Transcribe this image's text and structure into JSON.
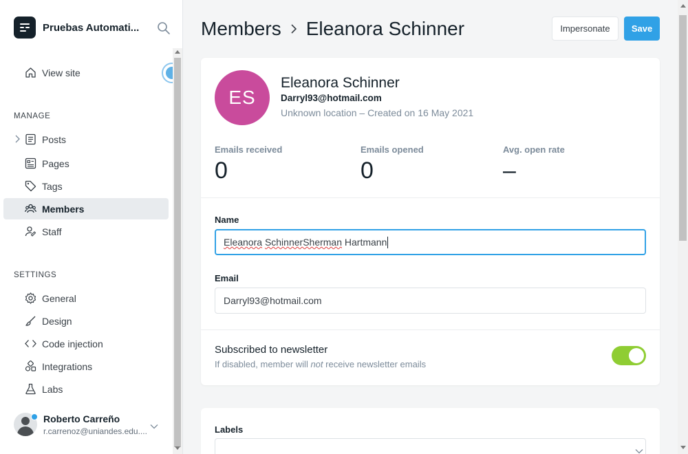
{
  "sidebar": {
    "brand": {
      "name": "Pruebas Automati..."
    },
    "view_site": "View site",
    "manage_title": "MANAGE",
    "manage_items": [
      {
        "label": "Posts",
        "icon": "posts-icon"
      },
      {
        "label": "Pages",
        "icon": "pages-icon"
      },
      {
        "label": "Tags",
        "icon": "tag-icon"
      },
      {
        "label": "Members",
        "icon": "members-icon",
        "active": true
      },
      {
        "label": "Staff",
        "icon": "staff-icon"
      }
    ],
    "settings_title": "SETTINGS",
    "settings_items": [
      {
        "label": "General",
        "icon": "gear-icon"
      },
      {
        "label": "Design",
        "icon": "brush-icon"
      },
      {
        "label": "Code injection",
        "icon": "code-icon"
      },
      {
        "label": "Integrations",
        "icon": "integrations-icon"
      },
      {
        "label": "Labs",
        "icon": "flask-icon"
      }
    ],
    "user": {
      "name": "Roberto Carreño",
      "email": "r.carrenoz@uniandes.edu...."
    }
  },
  "header": {
    "breadcrumb_parent": "Members",
    "breadcrumb_current": "Eleanora Schinner",
    "impersonate_label": "Impersonate",
    "save_label": "Save"
  },
  "member": {
    "initials": "ES",
    "name": "Eleanora Schinner",
    "email": "Darryl93@hotmail.com",
    "meta": "Unknown location – Created on 16 May 2021",
    "avatar_color": "#c94b9c"
  },
  "stats": [
    {
      "label": "Emails received",
      "value": "0"
    },
    {
      "label": "Emails opened",
      "value": "0"
    },
    {
      "label": "Avg. open rate",
      "value": "–"
    }
  ],
  "form": {
    "name_label": "Name",
    "name_value_part1": "Eleanora",
    "name_value_part2": "SchinnerSherman",
    "name_value_part3": "Hartmann",
    "email_label": "Email",
    "email_value": "Darryl93@hotmail.com",
    "newsletter_title": "Subscribed to newsletter",
    "newsletter_desc_before": "If disabled, member will ",
    "newsletter_desc_em": "not",
    "newsletter_desc_after": " receive newsletter emails",
    "newsletter_enabled": true,
    "labels_title": "Labels"
  },
  "colors": {
    "accent": "#30a1e6",
    "toggle_on": "#8fcd33"
  }
}
